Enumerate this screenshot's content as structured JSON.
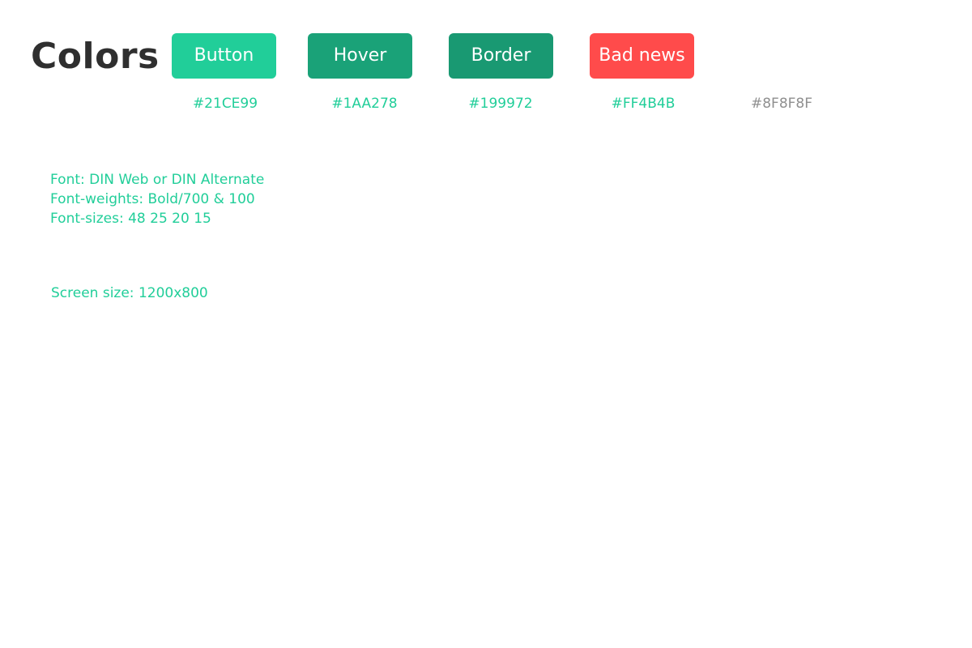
{
  "page": {
    "title": "Colors"
  },
  "swatches": [
    {
      "label": "Button",
      "hex": "#21CE99",
      "background": "#21ce99"
    },
    {
      "label": "Hover",
      "hex": "#1AA278",
      "background": "#1aa278"
    },
    {
      "label": "Border",
      "hex": "#199972",
      "background": "#199972"
    },
    {
      "label": "Bad news",
      "hex": "#FF4B4B",
      "background": "#ff4b4b"
    }
  ],
  "extra_color": {
    "hex": "#8F8F8F",
    "text_color": "#8f8f8f"
  },
  "hex_label_color": "#21ce99",
  "specs": {
    "font": "Font: DIN Web or DIN Alternate",
    "weights": "Font-weights: Bold/700 & 100",
    "sizes": "Font-sizes: 48 25 20 15",
    "screen_size": "Screen size: 1200x800"
  }
}
